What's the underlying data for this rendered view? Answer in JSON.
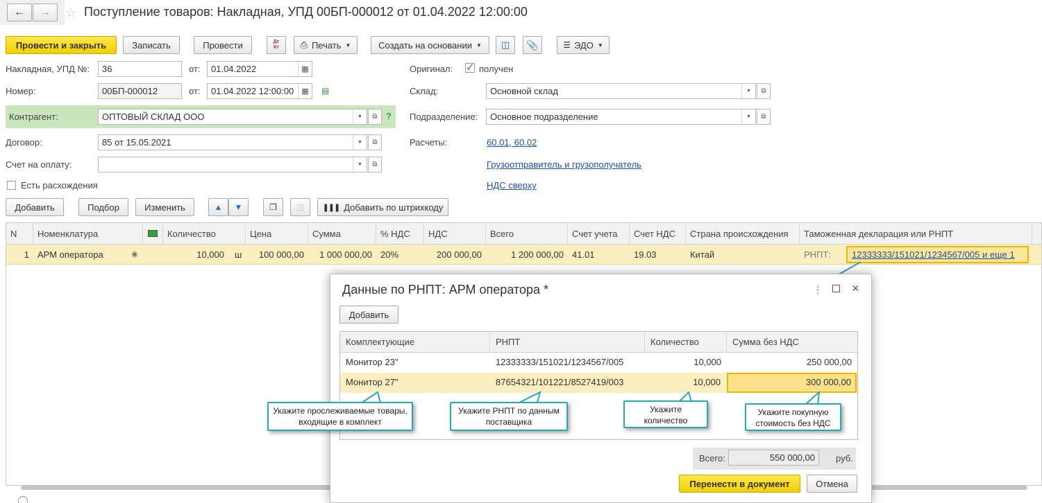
{
  "window": {
    "title": "Поступление товаров: Накладная, УПД 00БП-000012 от 01.04.2022 12:00:00"
  },
  "toolbar": {
    "post_close": "Провести и закрыть",
    "save": "Записать",
    "post": "Провести",
    "dt_kt": "Дт Кт",
    "print": "Печать",
    "create_based": "Создать на основании",
    "edo": "ЭДО"
  },
  "form": {
    "invoice_label": "Накладная, УПД №:",
    "invoice_value": "36",
    "from1_label": "от:",
    "from1_value": "01.04.2022",
    "number_label": "Номер:",
    "number_value": "00БП-000012",
    "from2_label": "от:",
    "from2_value": "01.04.2022 12:00:00",
    "counterparty_label": "Контрагент:",
    "counterparty_value": "ОПТОВЫЙ СКЛАД ООО",
    "help": "?",
    "contract_label": "Договор:",
    "contract_value": "85 от 15.05.2021",
    "payment_label": "Счет на оплату:",
    "payment_value": "",
    "discrepancy_label": "Есть расхождения",
    "original_label": "Оригинал:",
    "original_check_label": "получен",
    "warehouse_label": "Склад:",
    "warehouse_value": "Основной склад",
    "division_label": "Подразделение:",
    "division_value": "Основное подразделение",
    "settlements_label": "Расчеты:",
    "settlements_link": "60.01, 60.02",
    "shipper_link": "Грузоотправитель и грузополучатель",
    "vat_link": "НДС сверху"
  },
  "table_toolbar": {
    "add": "Добавить",
    "pick": "Подбор",
    "change": "Изменить",
    "barcode": "Добавить по штрихкоду"
  },
  "table": {
    "headers": [
      "N",
      "Номенклатура",
      "",
      "Количество",
      "Цена",
      "Сумма",
      "% НДС",
      "НДС",
      "Всего",
      "Счет учета",
      "Счет НДС",
      "Страна происхождения",
      "Таможенная декларация или РНПТ"
    ],
    "row": {
      "n": "1",
      "item": "АРМ оператора",
      "qty": "10,000",
      "unit": "ш",
      "price": "100 000,00",
      "sum": "1 000 000,00",
      "vat_rate": "20%",
      "vat": "200 000,00",
      "total": "1 200 000,00",
      "account": "41.01",
      "vat_account": "19.03",
      "country": "Китай",
      "rnpt_prefix": "РНПТ:",
      "rnpt_link": "12333333/151021/1234567/005 и еще 1"
    }
  },
  "dialog": {
    "title": "Данные по РНПТ: АРМ оператора *",
    "add": "Добавить",
    "headers": [
      "Комплектующие",
      "РНПТ",
      "Количество",
      "Сумма без НДС"
    ],
    "rows": [
      {
        "component": "Монитор 23\"",
        "rnpt": "12333333/151021/1234567/005",
        "qty": "10,000",
        "sum": "250 000,00"
      },
      {
        "component": "Монитор 27\"",
        "rnpt": "87654321/101221/8527419/003",
        "qty": "10,000",
        "sum": "300 000,00"
      }
    ],
    "total_label": "Всего:",
    "total_value": "550 000,00",
    "currency": "руб.",
    "transfer": "Перенести в документ",
    "cancel": "Отмена"
  },
  "callouts": {
    "c1": "Укажите прослеживаемые товары, входящие в комплект",
    "c2": "Укажите РНПТ по данным поставщика",
    "c3": "Укажите количество",
    "c4": "Укажите покупную стоимость без НДС"
  },
  "colors": {
    "accent_yellow": "#f5d400",
    "selected_row": "#fbefbf",
    "counterparty_bg": "#c9e6bf",
    "link": "#1f4e9c",
    "callout_border": "#2aa7b6"
  }
}
